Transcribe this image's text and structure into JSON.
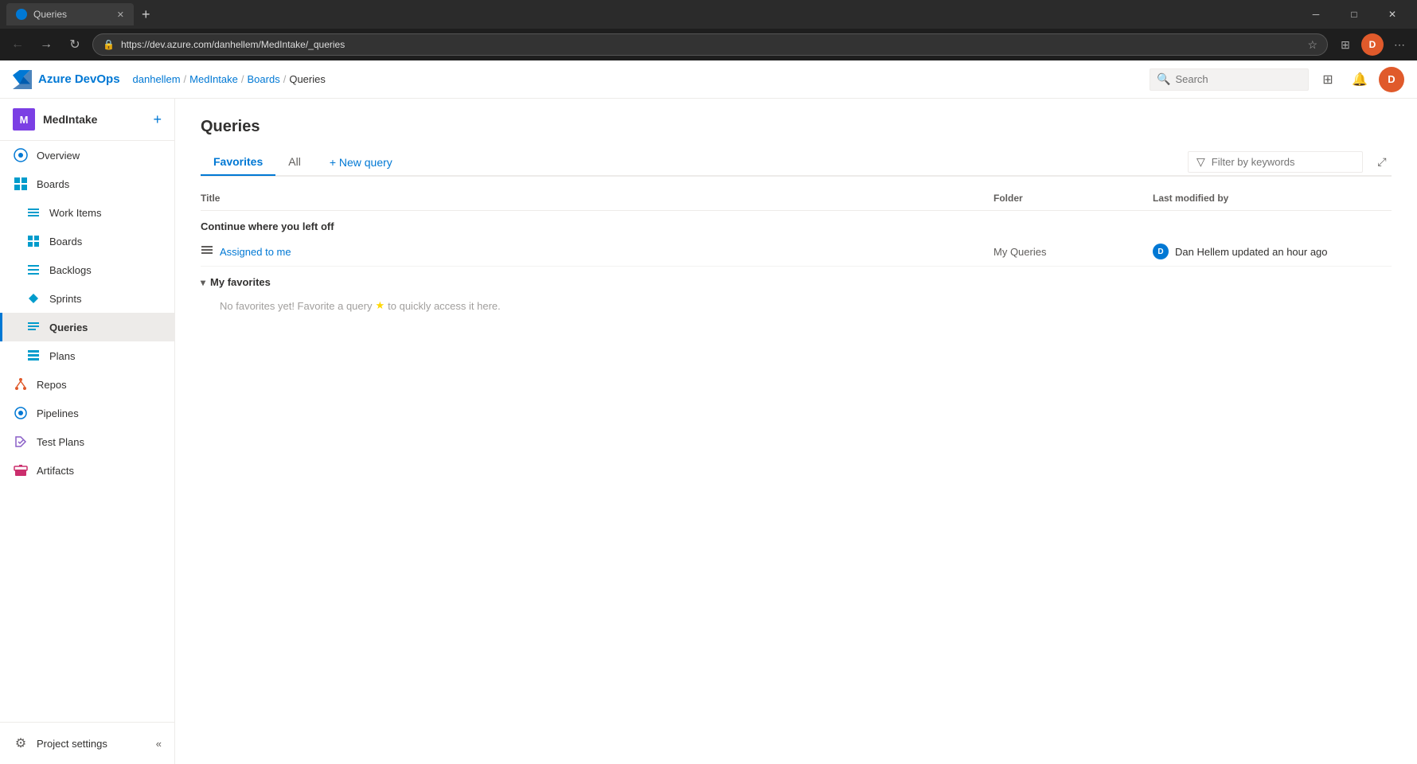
{
  "browser": {
    "tab_title": "Queries",
    "tab_favicon": "azure",
    "url": "https://dev.azure.com/danhellem/MedIntake/_queries",
    "new_tab_label": "+",
    "win_minimize": "─",
    "win_restore": "□",
    "win_close": "✕"
  },
  "header": {
    "logo_text": "Azure DevOps",
    "breadcrumb": [
      {
        "label": "danhellem",
        "href": true
      },
      {
        "label": "MedIntake",
        "href": true
      },
      {
        "label": "Boards",
        "href": true
      },
      {
        "label": "Queries",
        "href": false
      }
    ],
    "search_placeholder": "Search",
    "settings_icon": "⚙",
    "notification_icon": "🔔",
    "avatar_initials": "D"
  },
  "sidebar": {
    "project_avatar": "M",
    "project_name": "MedIntake",
    "add_btn": "+",
    "nav_items": [
      {
        "id": "overview",
        "label": "Overview",
        "icon": "⬡",
        "active": false
      },
      {
        "id": "boards",
        "label": "Boards",
        "icon": "⊞",
        "active": false
      },
      {
        "id": "work-items",
        "label": "Work Items",
        "icon": "≡",
        "active": false
      },
      {
        "id": "boards-sub",
        "label": "Boards",
        "icon": "⊞",
        "active": false
      },
      {
        "id": "backlogs",
        "label": "Backlogs",
        "icon": "☰",
        "active": false
      },
      {
        "id": "sprints",
        "label": "Sprints",
        "icon": "⟳",
        "active": false
      },
      {
        "id": "queries",
        "label": "Queries",
        "icon": "⊞",
        "active": true
      },
      {
        "id": "plans",
        "label": "Plans",
        "icon": "▤",
        "active": false
      },
      {
        "id": "repos",
        "label": "Repos",
        "icon": "⑂",
        "active": false
      },
      {
        "id": "pipelines",
        "label": "Pipelines",
        "icon": "⬡",
        "active": false
      },
      {
        "id": "test-plans",
        "label": "Test Plans",
        "icon": "✓",
        "active": false
      },
      {
        "id": "artifacts",
        "label": "Artifacts",
        "icon": "⬡",
        "active": false
      }
    ],
    "settings_label": "Project settings",
    "collapse_icon": "«"
  },
  "content": {
    "page_title": "Queries",
    "tabs": [
      {
        "id": "favorites",
        "label": "Favorites",
        "active": true
      },
      {
        "id": "all",
        "label": "All",
        "active": false
      }
    ],
    "new_query_label": "+ New query",
    "filter_placeholder": "Filter by keywords",
    "expand_icon": "⤢",
    "table": {
      "columns": [
        "Title",
        "Folder",
        "Last modified by"
      ],
      "section_continue": "Continue where you left off",
      "rows": [
        {
          "title": "Assigned to me",
          "folder": "My Queries",
          "modified_by": "Dan Hellem updated an hour ago",
          "avatar": "D"
        }
      ],
      "section_favorites": "My favorites",
      "no_favorites_text": "No favorites yet! Favorite a query",
      "star_icon": "★",
      "no_favorites_suffix": "to quickly access it here."
    }
  }
}
